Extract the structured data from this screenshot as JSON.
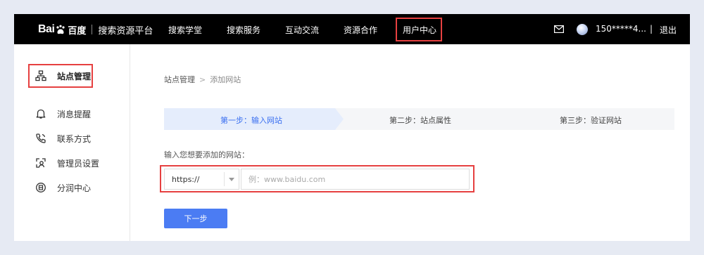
{
  "header": {
    "logo_text": "Bai",
    "logo_cn": "百度",
    "platform_name": "搜索资源平台",
    "nav": [
      {
        "label": "搜索学堂"
      },
      {
        "label": "搜索服务"
      },
      {
        "label": "互动交流"
      },
      {
        "label": "资源合作"
      },
      {
        "label": "用户中心"
      }
    ],
    "mail_icon": "mail-icon",
    "user_phone": "150*****4...",
    "separator": "|",
    "logout_label": "退出"
  },
  "sidebar": {
    "items": [
      {
        "label": "站点管理",
        "icon": "site-tree-icon"
      },
      {
        "label": "消息提醒",
        "icon": "bell-icon"
      },
      {
        "label": "联系方式",
        "icon": "phone-icon"
      },
      {
        "label": "管理员设置",
        "icon": "admin-icon"
      },
      {
        "label": "分润中心",
        "icon": "share-profit-icon"
      }
    ]
  },
  "main": {
    "breadcrumb": {
      "parent": "站点管理",
      "separator": ">",
      "current": "添加网站"
    },
    "steps": [
      {
        "label": "第一步：输入网站"
      },
      {
        "label": "第二步：站点属性"
      },
      {
        "label": "第三步：验证网站"
      }
    ],
    "field_label": "输入您想要添加的网站：",
    "protocol_value": "https://",
    "url_placeholder": "例：www.baidu.com",
    "next_label": "下一步"
  },
  "colors": {
    "accent": "#4b7cf3",
    "step_active_text": "#3a6ff0",
    "step_active_bg": "#e5edfc",
    "highlight": "#e64040",
    "topbar_bg": "#000000"
  }
}
